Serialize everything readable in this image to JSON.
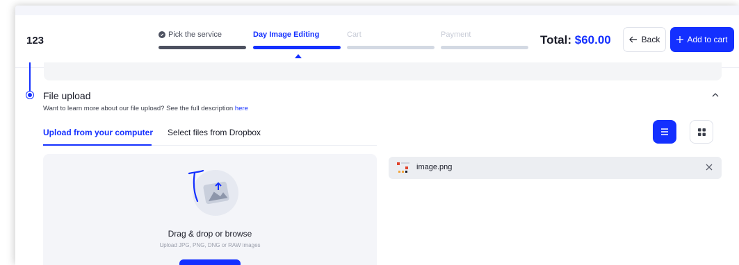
{
  "header": {
    "order_id": "123",
    "steps": [
      {
        "label": "Pick the service",
        "state": "done"
      },
      {
        "label": "Day Image Editing",
        "state": "active"
      },
      {
        "label": "Cart",
        "state": "pending"
      },
      {
        "label": "Payment",
        "state": "pending"
      }
    ],
    "total_label": "Total:",
    "total_amount": "$60.00",
    "back_label": "Back",
    "add_to_cart_label": "Add to cart"
  },
  "section": {
    "title": "File upload",
    "description": "Want to learn more about our file upload? See the full description",
    "description_link": "here"
  },
  "tabs": [
    {
      "label": "Upload from your computer",
      "active": true
    },
    {
      "label": "Select files from Dropbox",
      "active": false
    }
  ],
  "view_toggle": {
    "active": "list"
  },
  "dropzone": {
    "title": "Drag & drop or browse",
    "subtitle": "Upload JPG, PNG, DNG or RAW images"
  },
  "files": [
    {
      "name": "image.png"
    }
  ],
  "colors": {
    "accent": "#1430ff",
    "done": "#4d5160",
    "pending": "#d3d9e3"
  },
  "icons": {
    "back": "arrow-left-icon",
    "add": "plus-icon",
    "collapse": "chevron-up-icon",
    "list_view": "list-icon",
    "grid_view": "grid-icon",
    "file": "image-file-icon",
    "remove": "close-icon",
    "upload": "upload-illustration-icon"
  }
}
